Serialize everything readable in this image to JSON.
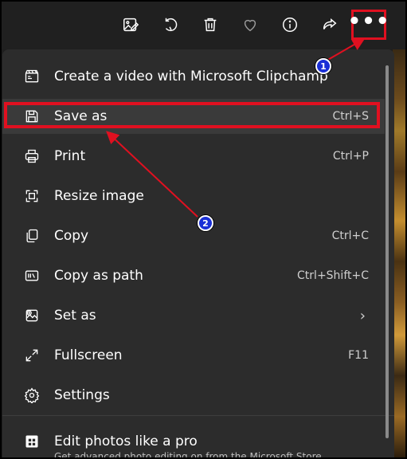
{
  "toolbar": {
    "buttons": [
      "edit-image-icon",
      "rotate-icon",
      "delete-icon",
      "favorite-icon",
      "info-icon",
      "share-icon"
    ],
    "more_label": "•••"
  },
  "menu": {
    "items": [
      {
        "label": "Create a video with Microsoft Clipchamp",
        "shortcut": "",
        "icon": "clipchamp-icon"
      },
      {
        "label": "Save as",
        "shortcut": "Ctrl+S",
        "icon": "save-icon"
      },
      {
        "label": "Print",
        "shortcut": "Ctrl+P",
        "icon": "print-icon"
      },
      {
        "label": "Resize image",
        "shortcut": "",
        "icon": "resize-icon"
      },
      {
        "label": "Copy",
        "shortcut": "Ctrl+C",
        "icon": "copy-icon"
      },
      {
        "label": "Copy as path",
        "shortcut": "Ctrl+Shift+C",
        "icon": "copy-path-icon"
      },
      {
        "label": "Set as",
        "shortcut": "",
        "icon": "set-as-icon",
        "submenu": "›"
      },
      {
        "label": "Fullscreen",
        "shortcut": "F11",
        "icon": "fullscreen-icon"
      },
      {
        "label": "Settings",
        "shortcut": "",
        "icon": "settings-icon"
      }
    ],
    "promo": {
      "label": "Edit photos like a pro",
      "subtitle": "Get advanced photo editing on from the Microsoft Store",
      "icon": "store-icon"
    }
  },
  "callouts": {
    "one": "1",
    "two": "2"
  },
  "colors": {
    "menu_bg": "#2c2c2c",
    "toolbar_bg": "#202020",
    "highlight": "#e01020",
    "badge": "#1a2fd6"
  }
}
